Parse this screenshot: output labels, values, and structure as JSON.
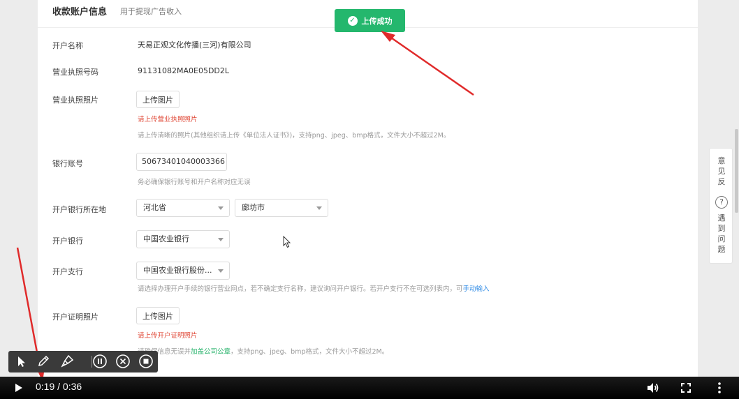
{
  "card": {
    "title": "收款账户信息",
    "subtitle": "用于提现广告收入"
  },
  "form": {
    "account_name_label": "开户名称",
    "account_name_value": "天易正观文化传播(三河)有限公司",
    "license_no_label": "营业执照号码",
    "license_no_value": "91131082MA0E05DD2L",
    "license_photo_label": "营业执照照片",
    "license_upload_button": "上传图片",
    "license_error": "请上传营业执照照片",
    "license_hint": "请上传清晰的照片(其他组织请上传《单位法人证书》)，支持png、jpeg、bmp格式，文件大小不超过2M。",
    "bank_account_label": "银行账号",
    "bank_account_value": "50673401040003366",
    "bank_account_hint": "务必确保银行账号和开户名称对应无误",
    "bank_location_label": "开户银行所在地",
    "province_value": "河北省",
    "city_value": "廊坊市",
    "bank_label": "开户银行",
    "bank_value": "中国农业银行",
    "branch_label": "开户支行",
    "branch_value": "中国农业银行股份...",
    "branch_hint": "请选择办理开户手续的银行营业网点，若不确定支行名称，建议询问开户银行。若开户支行不在可选列表内，可",
    "branch_hint_link": "手动输入",
    "proof_photo_label": "开户证明照片",
    "proof_upload_button": "上传图片",
    "proof_error": "请上传开户证明照片",
    "proof_hint_prefix": "请确保信息无误并",
    "proof_hint_green": "加盖公司公章",
    "proof_hint_suffix": "，支持png、jpeg、bmp格式，文件大小不超过2M。"
  },
  "toast": {
    "text": "上传成功"
  },
  "feedback": {
    "feedback_chars": [
      "意",
      "见",
      "反"
    ],
    "help_icon_char": "?",
    "help_chars": [
      "遇",
      "到",
      "问",
      "题"
    ]
  },
  "video": {
    "time": "0:19 / 0:36"
  },
  "colors": {
    "success_green": "#24b76d",
    "error_red": "#e04b3a",
    "link_blue": "#2f8be6",
    "annotation_arrow": "#e02a2a"
  },
  "icons": {
    "toast": "check-circle-icon",
    "annotation_tools": [
      "pointer-icon",
      "pen-icon",
      "brush-icon",
      "pause-icon",
      "close-icon",
      "stop-icon"
    ],
    "video": [
      "play-icon",
      "volume-icon",
      "fullscreen-icon",
      "more-icon"
    ]
  }
}
